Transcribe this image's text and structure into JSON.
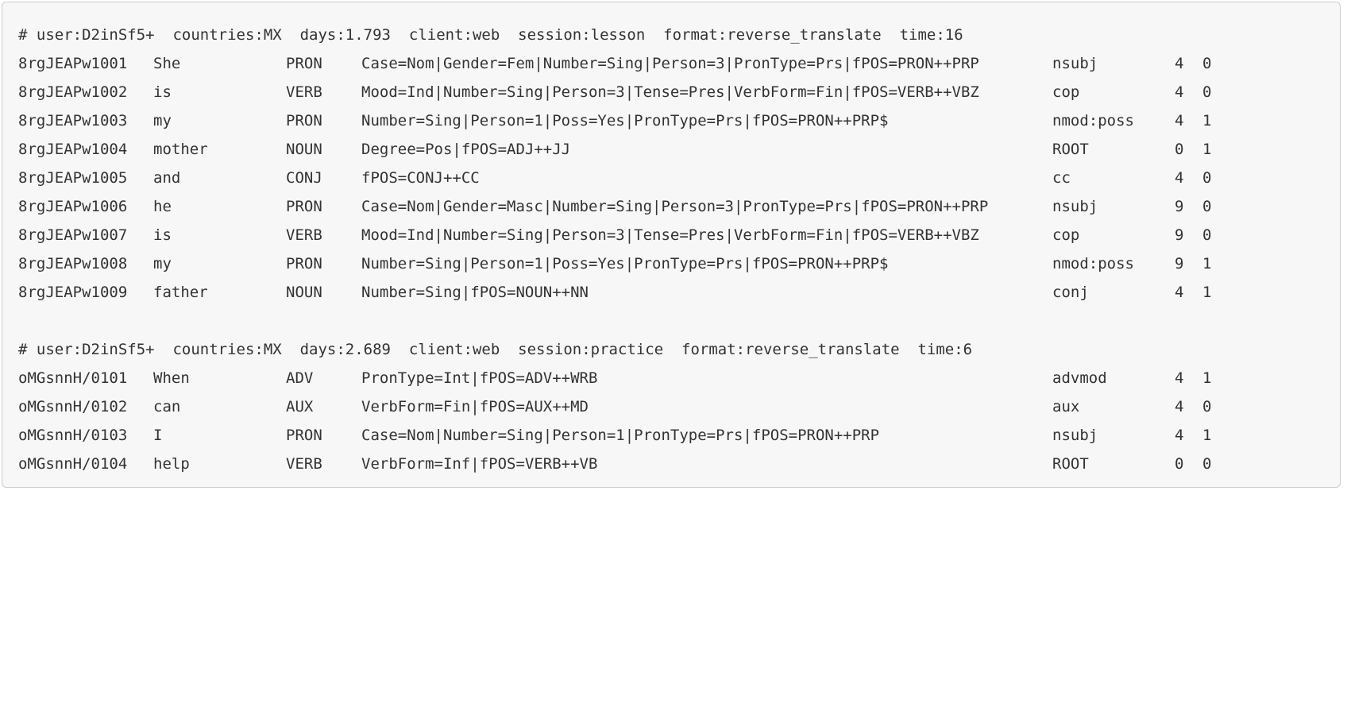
{
  "blocks": [
    {
      "header": "# user:D2inSf5+  countries:MX  days:1.793  client:web  session:lesson  format:reverse_translate  time:16",
      "rows": [
        {
          "id": "8rgJEAPw1001",
          "token": "She",
          "pos": "PRON",
          "feats": "Case=Nom|Gender=Fem|Number=Sing|Person=3|PronType=Prs|fPOS=PRON++PRP",
          "dep": "nsubj",
          "head": "4",
          "label": "0"
        },
        {
          "id": "8rgJEAPw1002",
          "token": "is",
          "pos": "VERB",
          "feats": "Mood=Ind|Number=Sing|Person=3|Tense=Pres|VerbForm=Fin|fPOS=VERB++VBZ",
          "dep": "cop",
          "head": "4",
          "label": "0"
        },
        {
          "id": "8rgJEAPw1003",
          "token": "my",
          "pos": "PRON",
          "feats": "Number=Sing|Person=1|Poss=Yes|PronType=Prs|fPOS=PRON++PRP$",
          "dep": "nmod:poss",
          "head": "4",
          "label": "1"
        },
        {
          "id": "8rgJEAPw1004",
          "token": "mother",
          "pos": "NOUN",
          "feats": "Degree=Pos|fPOS=ADJ++JJ",
          "dep": "ROOT",
          "head": "0",
          "label": "1"
        },
        {
          "id": "8rgJEAPw1005",
          "token": "and",
          "pos": "CONJ",
          "feats": "fPOS=CONJ++CC",
          "dep": "cc",
          "head": "4",
          "label": "0"
        },
        {
          "id": "8rgJEAPw1006",
          "token": "he",
          "pos": "PRON",
          "feats": "Case=Nom|Gender=Masc|Number=Sing|Person=3|PronType=Prs|fPOS=PRON++PRP",
          "dep": "nsubj",
          "head": "9",
          "label": "0"
        },
        {
          "id": "8rgJEAPw1007",
          "token": "is",
          "pos": "VERB",
          "feats": "Mood=Ind|Number=Sing|Person=3|Tense=Pres|VerbForm=Fin|fPOS=VERB++VBZ",
          "dep": "cop",
          "head": "9",
          "label": "0"
        },
        {
          "id": "8rgJEAPw1008",
          "token": "my",
          "pos": "PRON",
          "feats": "Number=Sing|Person=1|Poss=Yes|PronType=Prs|fPOS=PRON++PRP$",
          "dep": "nmod:poss",
          "head": "9",
          "label": "1"
        },
        {
          "id": "8rgJEAPw1009",
          "token": "father",
          "pos": "NOUN",
          "feats": "Number=Sing|fPOS=NOUN++NN",
          "dep": "conj",
          "head": "4",
          "label": "1"
        }
      ]
    },
    {
      "header": "# user:D2inSf5+  countries:MX  days:2.689  client:web  session:practice  format:reverse_translate  time:6",
      "rows": [
        {
          "id": "oMGsnnH/0101",
          "token": "When",
          "pos": "ADV",
          "feats": "PronType=Int|fPOS=ADV++WRB",
          "dep": "advmod",
          "head": "4",
          "label": "1"
        },
        {
          "id": "oMGsnnH/0102",
          "token": "can",
          "pos": "AUX",
          "feats": "VerbForm=Fin|fPOS=AUX++MD",
          "dep": "aux",
          "head": "4",
          "label": "0"
        },
        {
          "id": "oMGsnnH/0103",
          "token": "I",
          "pos": "PRON",
          "feats": "Case=Nom|Number=Sing|Person=1|PronType=Prs|fPOS=PRON++PRP",
          "dep": "nsubj",
          "head": "4",
          "label": "1"
        },
        {
          "id": "oMGsnnH/0104",
          "token": "help",
          "pos": "VERB",
          "feats": "VerbForm=Inf|fPOS=VERB++VB",
          "dep": "ROOT",
          "head": "0",
          "label": "0"
        }
      ]
    }
  ],
  "colors": {
    "background": "#f7f7f7",
    "border": "#cccccc",
    "text": "#333333"
  }
}
